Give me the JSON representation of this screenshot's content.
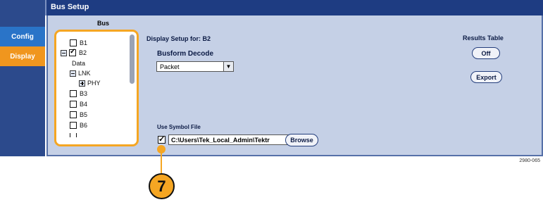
{
  "window": {
    "title": "Bus Setup"
  },
  "sidebar": {
    "tabs": [
      {
        "label": "Config",
        "active": false
      },
      {
        "label": "Display",
        "active": true
      }
    ]
  },
  "bus_list": {
    "heading": "Bus",
    "items": [
      {
        "label": "B1",
        "type": "checkbox",
        "checked": false
      },
      {
        "label": "B2",
        "type": "checkbox",
        "checked": true,
        "expandable": true
      },
      {
        "label": "Data",
        "type": "text"
      },
      {
        "label": "LNK",
        "type": "group",
        "expanded": true
      },
      {
        "label": "PHY",
        "type": "group",
        "expanded": false
      },
      {
        "label": "B3",
        "type": "checkbox",
        "checked": false
      },
      {
        "label": "B4",
        "type": "checkbox",
        "checked": false
      },
      {
        "label": "B5",
        "type": "checkbox",
        "checked": false
      },
      {
        "label": "B6",
        "type": "checkbox",
        "checked": false
      }
    ]
  },
  "display_setup": {
    "label": "Display Setup for:  B2",
    "busform_label": "Busform Decode",
    "busform_value": "Packet"
  },
  "symbol_file": {
    "label": "Use Symbol File",
    "checked": true,
    "path": "C:\\Users\\Tek_Local_Admin\\Tektr",
    "browse_label": "Browse"
  },
  "results_table": {
    "heading": "Results Table",
    "off_label": "Off",
    "export_label": "Export"
  },
  "callout": {
    "number": "7"
  },
  "figure_id": "2980-065",
  "colors": {
    "title_bar": "#1e3c82",
    "panel_bg": "#c5d0e6",
    "accent_orange": "#f5a623",
    "config_tab": "#2a74c8"
  }
}
